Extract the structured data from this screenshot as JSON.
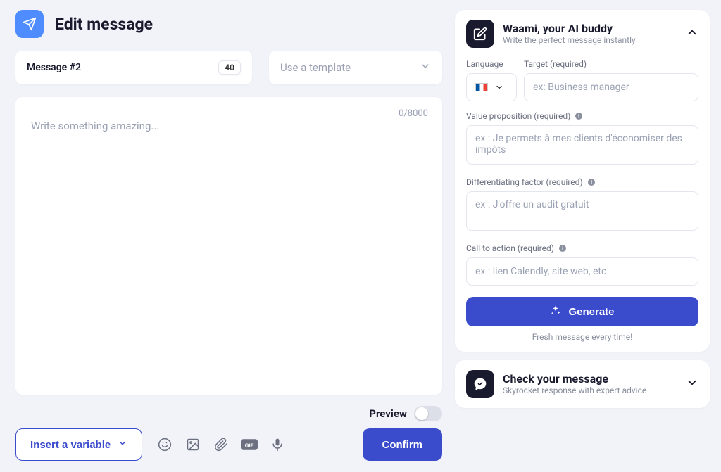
{
  "header": {
    "title": "Edit message"
  },
  "message": {
    "label": "Message #2",
    "badge": "40"
  },
  "template": {
    "placeholder": "Use a template"
  },
  "editor": {
    "placeholder": "Write something amazing...",
    "counter": "0/8000"
  },
  "preview": {
    "label": "Preview",
    "on": false
  },
  "toolbar": {
    "insert_variable": "Insert a variable",
    "confirm": "Confirm"
  },
  "waami": {
    "title": "Waami, your AI buddy",
    "subtitle": "Write the perfect message instantly",
    "language_label": "Language",
    "target": {
      "label": "Target (required)",
      "placeholder": "ex: Business manager"
    },
    "value": {
      "label": "Value proposition (required)",
      "placeholder": "ex : Je permets à mes clients d'économiser des impôts"
    },
    "diff": {
      "label": "Differentiating factor (required)",
      "placeholder": "ex : J'offre un audit gratuit"
    },
    "cta": {
      "label": "Call to action (required)",
      "placeholder": "ex : lien Calendly, site web, etc"
    },
    "generate": "Generate",
    "fresh": "Fresh message every time!"
  },
  "check": {
    "title": "Check your message",
    "subtitle": "Skyrocket response with expert advice"
  }
}
